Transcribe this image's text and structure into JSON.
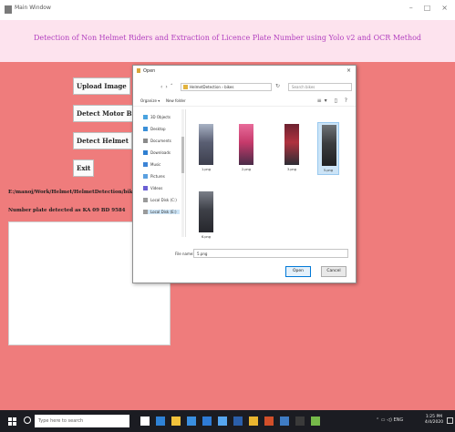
{
  "window": {
    "title": "Main Window",
    "controls": [
      "–",
      "□",
      "×"
    ]
  },
  "header": {
    "title": "Detection of Non Helmet Riders and Extraction of Licence Plate Number using Yolo v2 and OCR Method"
  },
  "buttons": {
    "upload": "Upload Image",
    "detect_rider": "Detect Motor Bike & Person",
    "detect_helmet": "Detect Helmet",
    "exit": "Exit"
  },
  "status": {
    "line1": "E:/manoj/Work/Helmet/HelmetDetection/bikes/5.png",
    "line2": "Number plate detected as KA 09 BD 9584"
  },
  "dialog": {
    "title": "Open",
    "address": "HelmetDetection  ›  bikes",
    "search_placeholder": "Search bikes",
    "toolbar": [
      "Organize ▾",
      "New folder"
    ],
    "nav_items": [
      {
        "label": "3D Objects",
        "icon": "cube-icon",
        "color": "#4aa3df"
      },
      {
        "label": "Desktop",
        "icon": "desktop-icon",
        "color": "#3a8fd8"
      },
      {
        "label": "Documents",
        "icon": "documents-icon",
        "color": "#8a8a8a"
      },
      {
        "label": "Downloads",
        "icon": "download-icon",
        "color": "#2f7fd1"
      },
      {
        "label": "Music",
        "icon": "music-icon",
        "color": "#3c84d6"
      },
      {
        "label": "Pictures",
        "icon": "pictures-icon",
        "color": "#5aa0e0"
      },
      {
        "label": "Videos",
        "icon": "videos-icon",
        "color": "#6b5fd4"
      },
      {
        "label": "Local Disk (C:)",
        "icon": "drive-icon",
        "color": "#9a9a9a"
      },
      {
        "label": "Local Disk (E:)",
        "icon": "drive-icon",
        "color": "#9a9a9a"
      }
    ],
    "files": [
      {
        "name": "1.png",
        "colors": [
          "#5a5f73",
          "#a8b2c4",
          "#3d3f4d"
        ]
      },
      {
        "name": "2.png",
        "colors": [
          "#c63a6b",
          "#e86b9a",
          "#4a2c48"
        ]
      },
      {
        "name": "3.png",
        "colors": [
          "#b0323f",
          "#6d2230",
          "#2d2d35"
        ]
      },
      {
        "name": "5.png",
        "colors": [
          "#3b3d3f",
          "#6d7276",
          "#1f2022"
        ]
      },
      {
        "name": "6.png",
        "colors": [
          "#3e4048",
          "#7a7f88",
          "#26272c"
        ]
      }
    ],
    "file_name_label": "File name:",
    "file_name_value": "5.png",
    "open_label": "Open",
    "cancel_label": "Cancel"
  },
  "taskbar": {
    "search_placeholder": "Type here to search",
    "apps": [
      {
        "icon": "task-view-icon",
        "color": "#ffffff"
      },
      {
        "icon": "edge-icon",
        "color": "#2f82d6"
      },
      {
        "icon": "file-explorer-icon",
        "color": "#f2c23b"
      },
      {
        "icon": "store-icon",
        "color": "#3a8fe0"
      },
      {
        "icon": "mail-icon",
        "color": "#2e7bd6"
      },
      {
        "icon": "photos-icon",
        "color": "#56a6f0"
      },
      {
        "icon": "word-icon",
        "color": "#2b5faa"
      },
      {
        "icon": "chrome-icon",
        "color": "#e9b52f"
      },
      {
        "icon": "firefox-icon",
        "color": "#d24f2a"
      },
      {
        "icon": "python-icon",
        "color": "#3f7cc4"
      },
      {
        "icon": "terminal-icon",
        "color": "#3a3a3a"
      },
      {
        "icon": "app-icon",
        "color": "#76b94a"
      }
    ],
    "tray_text": "⌃ ▭ ◁) ENG",
    "time": "1:25 PM",
    "date": "4/4/2020"
  }
}
